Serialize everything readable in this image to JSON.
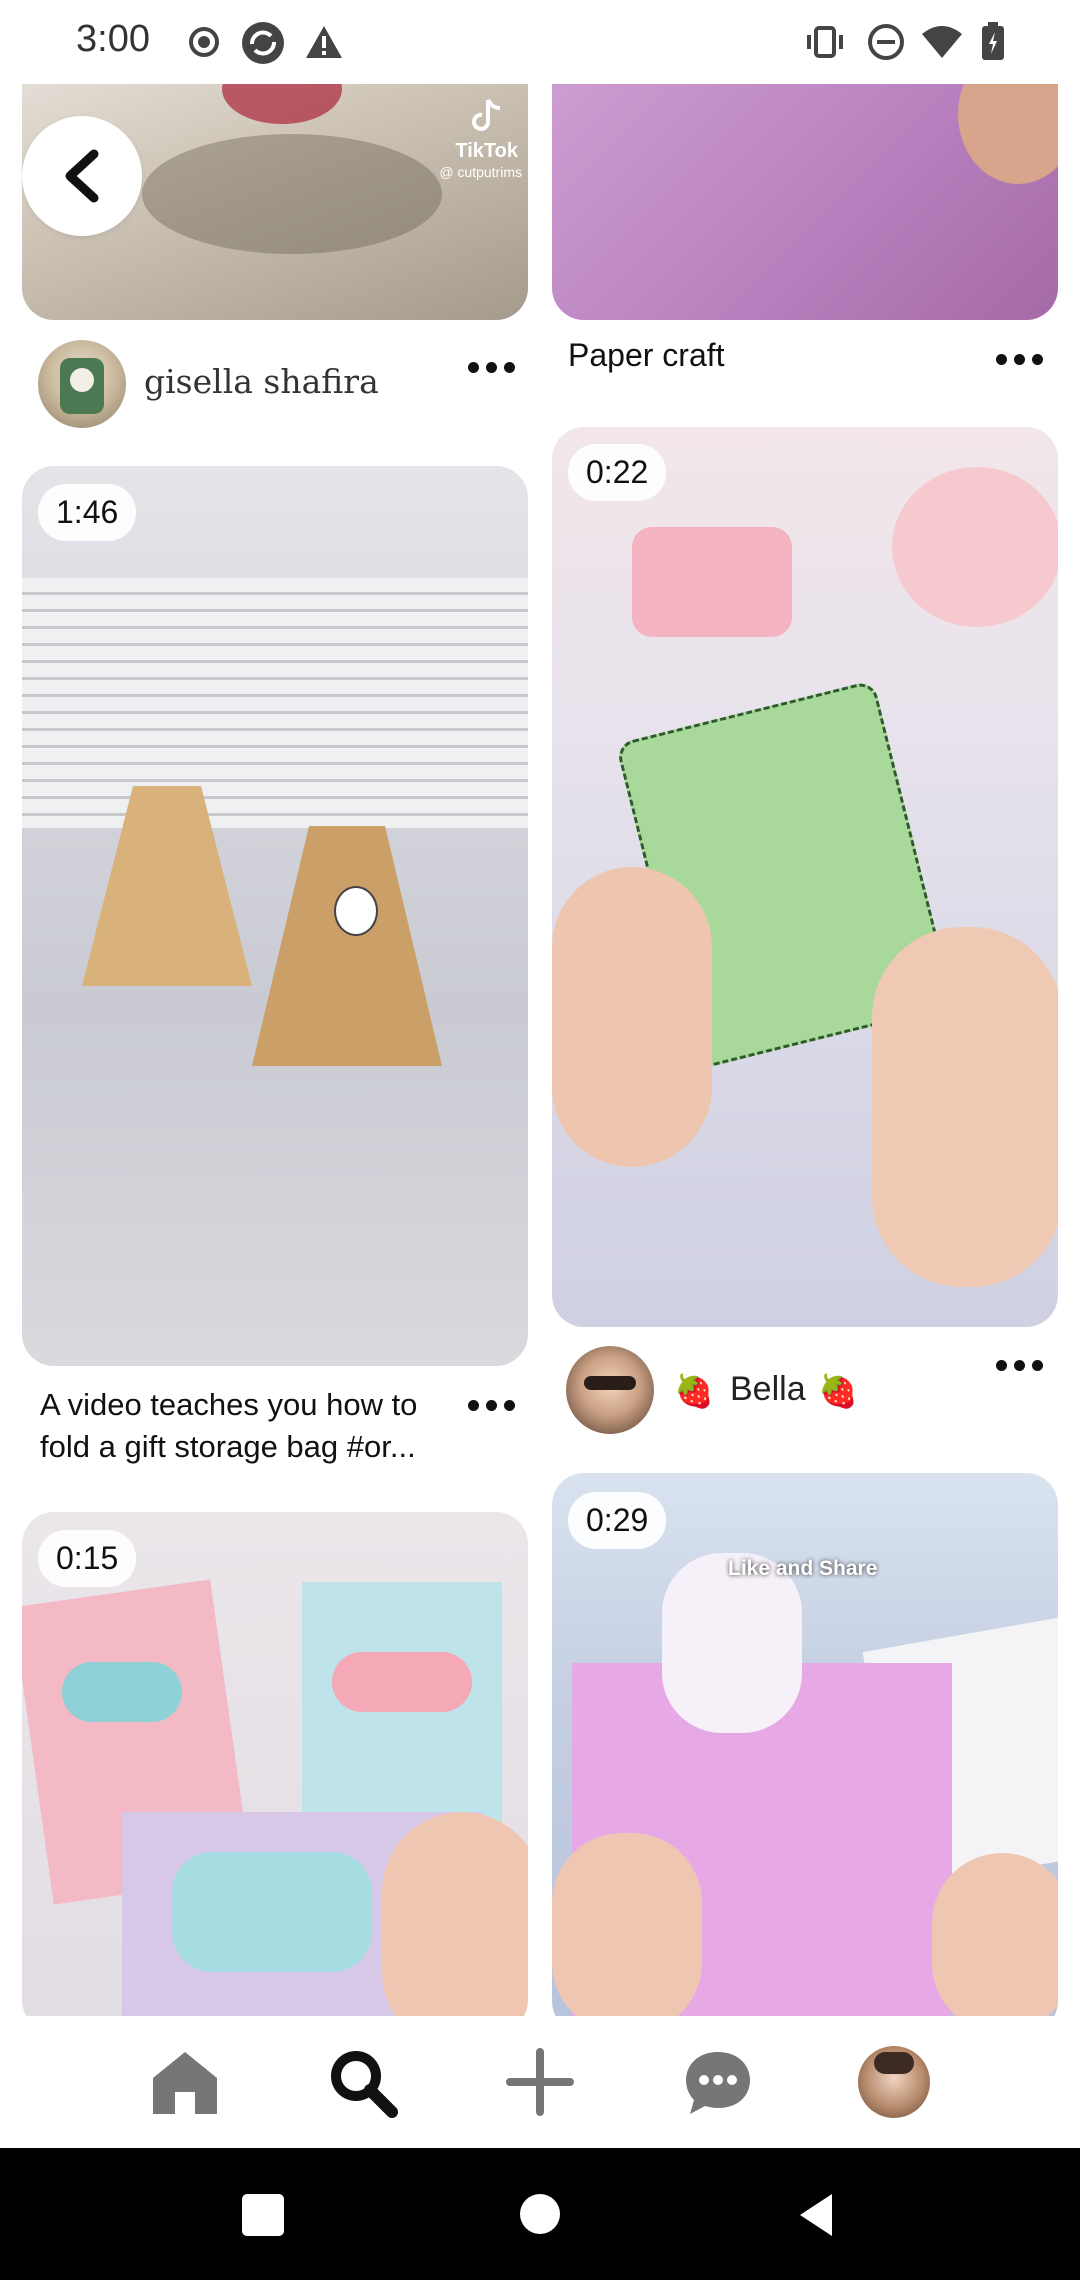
{
  "status_bar": {
    "time": "3:00",
    "left_icons": [
      "record-icon",
      "sync-icon",
      "warning-icon"
    ],
    "right_icons": [
      "vibrate-icon",
      "do-not-disturb-icon",
      "wifi-icon",
      "battery-icon"
    ]
  },
  "feed": {
    "pins": [
      {
        "id": "top-left",
        "watermark": "TikTok",
        "watermark_handle": "@ cutputrims",
        "author": "gisella shafira"
      },
      {
        "id": "top-right",
        "title": "Paper craft"
      },
      {
        "id": "mid-left",
        "duration": "1:46",
        "title": "A video teaches you how to fold a gift storage bag #or..."
      },
      {
        "id": "mid-right",
        "duration": "0:22",
        "author_prefix": "🍓",
        "author": "Bella",
        "author_suffix": "🍓"
      },
      {
        "id": "bottom-left",
        "duration": "0:15"
      },
      {
        "id": "bottom-right",
        "duration": "0:29",
        "overlay_text": "Like and Share"
      }
    ]
  },
  "bottom_nav": {
    "items": [
      "home-icon",
      "search-icon",
      "add-icon",
      "messages-icon",
      "profile-avatar"
    ],
    "active": "search"
  },
  "system_nav": [
    "recents-button",
    "home-button",
    "back-button"
  ]
}
